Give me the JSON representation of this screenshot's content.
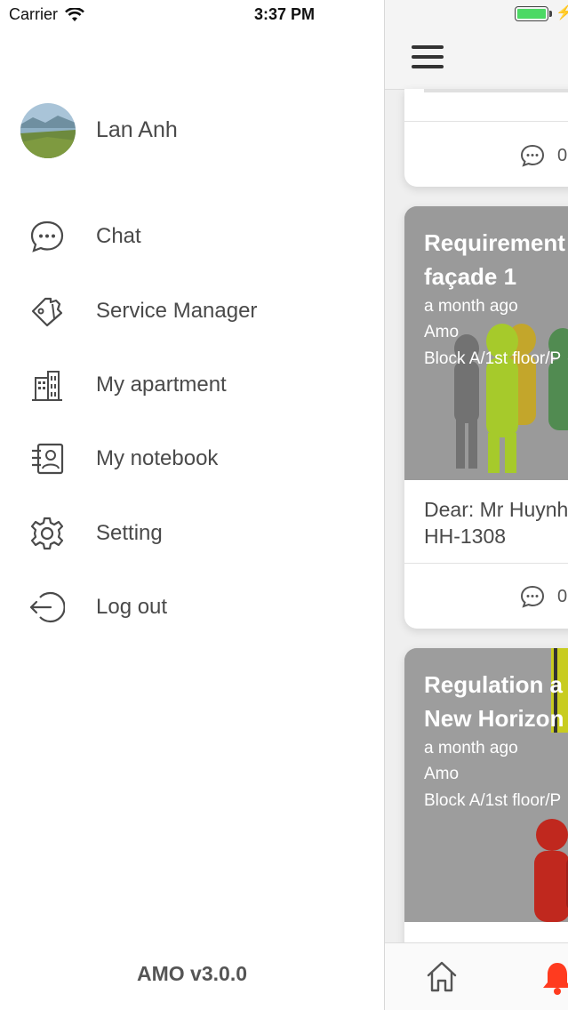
{
  "status_bar": {
    "carrier": "Carrier",
    "time": "3:37 PM"
  },
  "drawer": {
    "user_name": "Lan Anh",
    "menu": [
      {
        "label": "Chat",
        "icon": "chat-bubble-icon"
      },
      {
        "label": "Service Manager",
        "icon": "service-tag-icon"
      },
      {
        "label": "My apartment",
        "icon": "building-icon"
      },
      {
        "label": "My notebook",
        "icon": "contact-book-icon"
      },
      {
        "label": "Setting",
        "icon": "gear-icon"
      },
      {
        "label": "Log out",
        "icon": "logout-icon"
      }
    ],
    "version": "AMO v3.0.0"
  },
  "feed": {
    "cards": [
      {
        "comment_count": "0"
      },
      {
        "title_line1": "Requirement",
        "title_line2": "façade 1",
        "time": "a month ago",
        "author": "Amo",
        "location": "Block A/1st floor/P",
        "body_line1": "Dear: Mr Huynh",
        "body_line2": "HH-1308",
        "comment_count": "0"
      },
      {
        "title_line1": "Regulation a",
        "title_line2": "New Horizon",
        "time": "a month ago",
        "author": "Amo",
        "location": "Block A/1st floor/P"
      }
    ]
  },
  "colors": {
    "accent": "#ff3b1f",
    "text": "#4a4a4a",
    "battery": "#4cd964"
  }
}
